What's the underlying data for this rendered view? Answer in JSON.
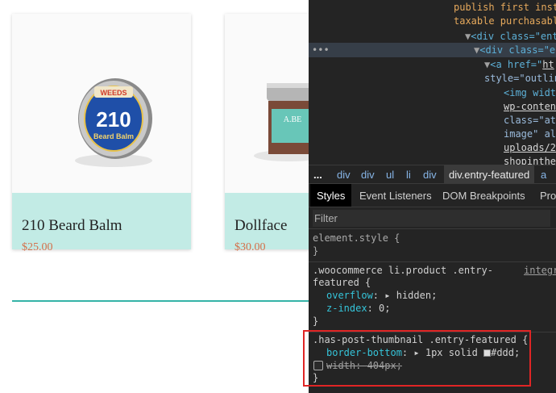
{
  "products": [
    {
      "name": "210 Beard Balm",
      "price": "$25.00",
      "badge_brand": "WEEDS",
      "badge_number": "210",
      "badge_text": "Beard Balm"
    },
    {
      "name": "Dollface",
      "price": "$30.00",
      "jar_text": "A.BE"
    }
  ],
  "devtools": {
    "elements": {
      "line1": "publish first inst",
      "line2": "taxable purchasabl",
      "line3_tag": "<div class=\"ent",
      "line4_tag": "<div class=\"e",
      "line5_tag": "<a href=\"",
      "line5_link": "ht",
      "line6_attr": "style=\"outlin",
      "line7_tag": "<img widt",
      "line8_link": "wp-conten",
      "line9_attr": "class=\"att",
      "line10_attr": "image\" al",
      "line11_link": "uploads/2",
      "line12_link": "shopinthe",
      "ellipsis": "•••"
    },
    "breadcrumbs": [
      "...",
      "div",
      "div",
      "ul",
      "li",
      "div",
      "div.entry-featured",
      "a"
    ],
    "tabs": [
      "Styles",
      "Event Listeners",
      "DOM Breakpoints",
      "Pro"
    ],
    "filter_placeholder": "Filter",
    "rules": {
      "element_style": "element.style {",
      "close": "}",
      "rule2_selector_1": ".woocommerce li.product .entry-",
      "rule2_selector_2": "featured {",
      "rule2_source": "integr",
      "rule2_prop1": "overflow",
      "rule2_val1": "hidden;",
      "rule2_prop2": "z-index",
      "rule2_val2": "0;",
      "rule3_selector": ".has-post-thumbnail .entry-featured {",
      "rule3_prop1": "border-bottom",
      "rule3_val1a": "1px solid ",
      "rule3_val1b": "#ddd;",
      "rule3_prop2": "width: 404px;"
    }
  }
}
